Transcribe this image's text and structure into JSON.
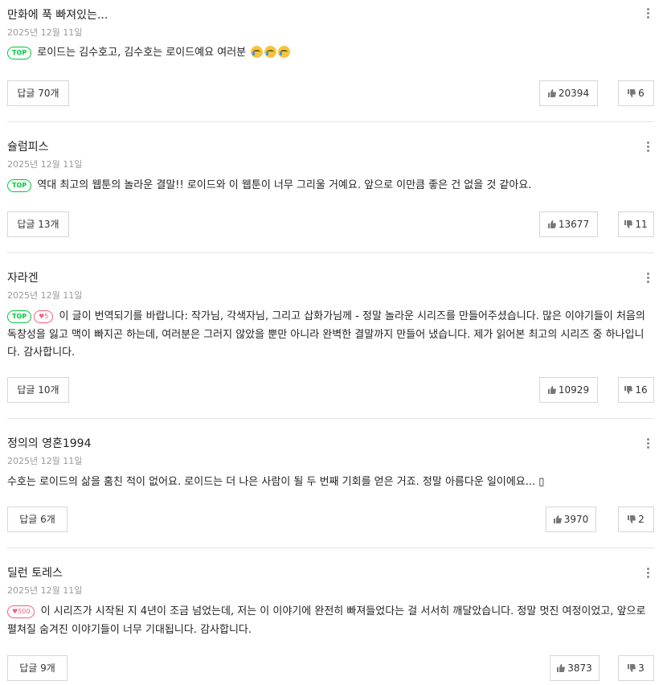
{
  "comments": [
    {
      "author": "만화에 푹 빠져있는...",
      "date": "2025년 12월 11일",
      "badges": [
        "TOP"
      ],
      "text": "로이드는 김수호고, 김수호는 로이드예요 여러분",
      "emojis": [
        "crying-face",
        "crying-face",
        "crying-face"
      ],
      "reply_label": "답글 70개",
      "likes": "20394",
      "dislikes": "6"
    },
    {
      "author": "슐럼피스",
      "date": "2025년 12월 11일",
      "badges": [
        "TOP"
      ],
      "text": "역대 최고의 웹툰의 놀라운 결말!! 로이드와 이 웹툰이 너무 그리울 거예요. 앞으로 이만큼 좋은 건 없을 것 같아요.",
      "reply_label": "답글 13개",
      "likes": "13677",
      "dislikes": "11"
    },
    {
      "author": "자라겐",
      "date": "2025년 12월 11일",
      "badges": [
        "TOP"
      ],
      "heart_badge": "5",
      "text": "이 글이 번역되기를 바랍니다: 작가님, 각색자님, 그리고 삽화가님께 - 정말 놀라운 시리즈를 만들어주셨습니다. 많은 이야기들이 처음의 독창성을 잃고 맥이 빠지곤 하는데, 여러분은 그러지 않았을 뿐만 아니라 완벽한 결말까지 만들어 냈습니다. 제가 읽어본 최고의 시리즈 중 하나입니다. 감사합니다.",
      "reply_label": "답글 10개",
      "likes": "10929",
      "dislikes": "16"
    },
    {
      "author": "정의의 영혼1994",
      "date": "2025년 12월 11일",
      "text": "수호는 로이드의 삶을 훔친 적이 없어요. 로이드는 더 나은 사람이 될 두 번째 기회를 얻은 거죠. 정말 아름다운 일이에요... ▯",
      "reply_label": "답글 6개",
      "likes": "3970",
      "dislikes": "2"
    },
    {
      "author": "딜런 토레스",
      "date": "2025년 12월 11일",
      "heart_badge": "500",
      "text": "이 시리즈가 시작된 지 4년이 조금 넘었는데, 저는 이 이야기에 완전히 빠져들었다는 걸 서서히 깨달았습니다. 정말 멋진 여정이었고, 앞으로 펼쳐질 숨겨진 이야기들이 너무 기대됩니다. 감사합니다.",
      "reply_label": "답글 9개",
      "likes": "3873",
      "dislikes": "3"
    }
  ],
  "colors": {
    "top_badge": "#00c73c",
    "heart_badge": "#f0607a",
    "border": "#d6d6d6",
    "date": "#9a9a9a"
  },
  "icons": {
    "like": "thumbs-up-icon",
    "dislike": "thumbs-down-icon",
    "more": "more-vertical-icon",
    "heart": "heart-icon"
  }
}
